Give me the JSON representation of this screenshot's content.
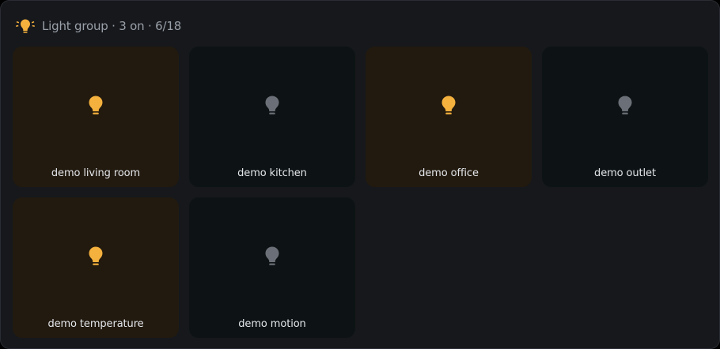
{
  "group": {
    "title": "Light group · 3 on · 6/18",
    "icon": "lightbulb-group-icon"
  },
  "colors": {
    "on": "#f5b13d",
    "off": "#6b7078",
    "tile_on_bg": "#221a0f",
    "tile_off_bg": "#0d1314"
  },
  "tiles": [
    {
      "label": "demo living room",
      "state": "on",
      "icon": "lightbulb-icon"
    },
    {
      "label": "demo kitchen",
      "state": "off",
      "icon": "lightbulb-icon"
    },
    {
      "label": "demo office",
      "state": "on",
      "icon": "lightbulb-icon"
    },
    {
      "label": "demo outlet",
      "state": "off",
      "icon": "lightbulb-icon"
    },
    {
      "label": "demo temperature",
      "state": "on",
      "icon": "lightbulb-icon"
    },
    {
      "label": "demo motion",
      "state": "off",
      "icon": "lightbulb-icon"
    }
  ]
}
